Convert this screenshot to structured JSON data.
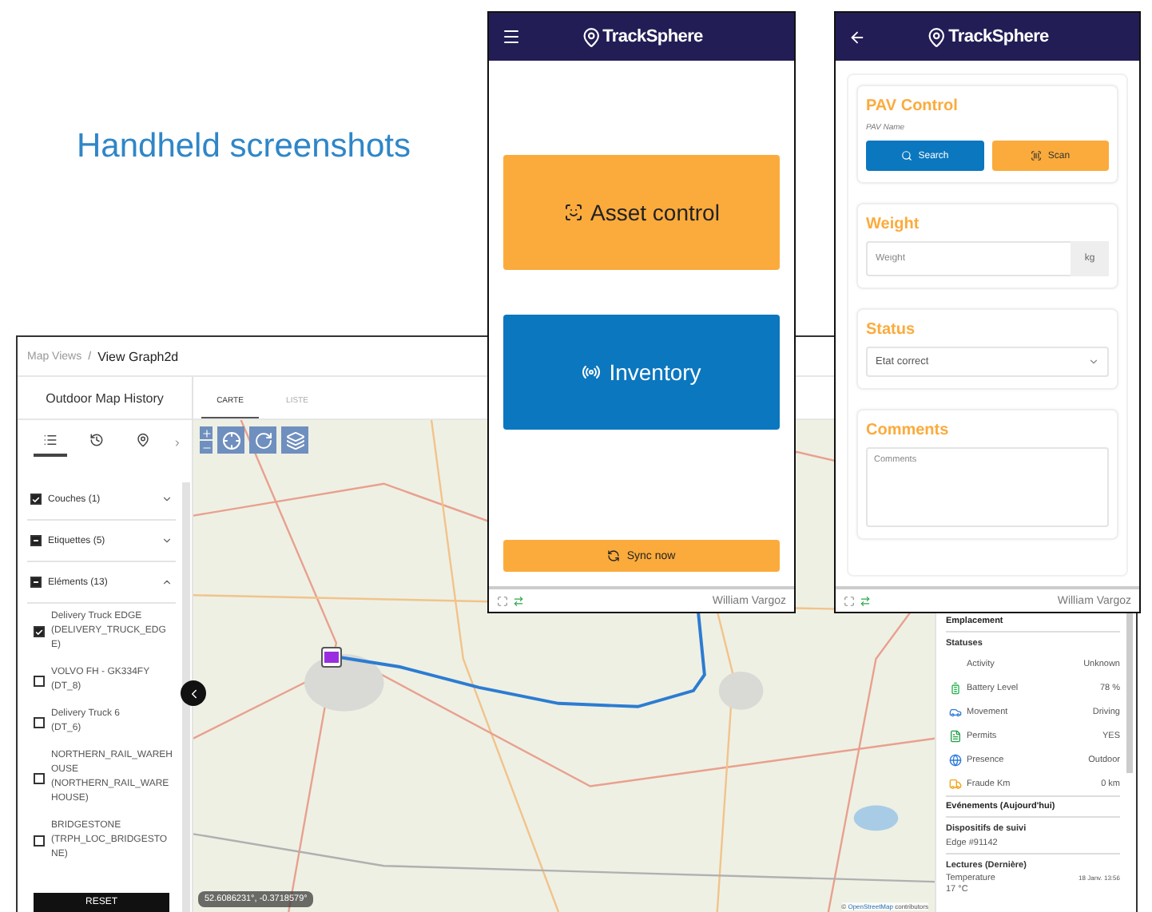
{
  "headline": "Handheld screenshots",
  "desktop": {
    "breadcrumb": [
      "Map Views",
      "View Graph2d"
    ],
    "breadcrumb_separator": "/",
    "sidebar": {
      "title": "Outdoor Map History",
      "view_tabs": [
        {
          "kind": "list",
          "selected": true
        },
        {
          "kind": "history",
          "selected": false
        },
        {
          "kind": "pin",
          "selected": false
        }
      ],
      "groups": [
        {
          "label": "Couches (1)",
          "checked": true,
          "indeterminate": false,
          "expanded": false
        },
        {
          "label": "Etiquettes (5)",
          "checked": false,
          "indeterminate": true,
          "expanded": false
        },
        {
          "label": "Eléments (13)",
          "checked": false,
          "indeterminate": true,
          "expanded": true,
          "items": [
            {
              "name": "Delivery Truck EDGE",
              "code": "(DELIVERY_TRUCK_EDGE)",
              "checked": true
            },
            {
              "name": "VOLVO FH - GK334FY",
              "code": "(DT_8)",
              "checked": false
            },
            {
              "name": "Delivery Truck 6",
              "code": "(DT_6)",
              "checked": false
            },
            {
              "name": "NORTHERN_RAIL_WAREHOUSE",
              "code": "(NORTHERN_RAIL_WAREHOUSE)",
              "checked": false
            },
            {
              "name": "BRIDGESTONE",
              "code": "(TRPH_LOC_BRIDGESTONE)",
              "checked": false
            }
          ]
        }
      ],
      "reset": "RESET"
    },
    "tabs": [
      {
        "label": "CARTE",
        "selected": true
      },
      {
        "label": "LISTE",
        "selected": false
      }
    ],
    "map": {
      "coordinates": "52.6086231°, -0.3718579°",
      "attribution_prefix": "©",
      "attribution_link": "OpenStreetMap",
      "attribution_suffix": "contributors"
    },
    "panel": {
      "location_title": "Emplacement",
      "statuses_title": "Statuses",
      "statuses": [
        {
          "kind": "plain",
          "label": "Activity",
          "value": "Unknown"
        },
        {
          "kind": "battery",
          "label": "Battery Level",
          "value": "78 %"
        },
        {
          "kind": "car",
          "label": "Movement",
          "value": "Driving"
        },
        {
          "kind": "document",
          "label": "Permits",
          "value": "YES"
        },
        {
          "kind": "globe",
          "label": "Presence",
          "value": "Outdoor"
        },
        {
          "kind": "truck",
          "label": "Fraude Km",
          "value": "0 km"
        }
      ],
      "events_title": "Evénements (Aujourd'hui)",
      "devices_title": "Dispositifs de suivi",
      "device": "Edge #91142",
      "readings_title": "Lectures (Dernière)",
      "reading": {
        "label": "Temperature",
        "time": "18 Janv. 13:56",
        "value": "17 °C"
      }
    }
  },
  "phone_home": {
    "brand": "TrackSphere",
    "actions": [
      {
        "kind": "asset",
        "label": "Asset control"
      },
      {
        "kind": "inventory",
        "label": "Inventory"
      }
    ],
    "sync": "Sync now",
    "user": "William Vargoz"
  },
  "phone_form": {
    "brand": "TrackSphere",
    "pav": {
      "title": "PAV Control",
      "field_label": "PAV Name",
      "search": "Search",
      "scan": "Scan"
    },
    "weight": {
      "title": "Weight",
      "placeholder": "Weight",
      "unit": "kg"
    },
    "status": {
      "title": "Status",
      "value": "Etat correct"
    },
    "comments": {
      "title": "Comments",
      "placeholder": "Comments"
    },
    "user": "William Vargoz"
  }
}
